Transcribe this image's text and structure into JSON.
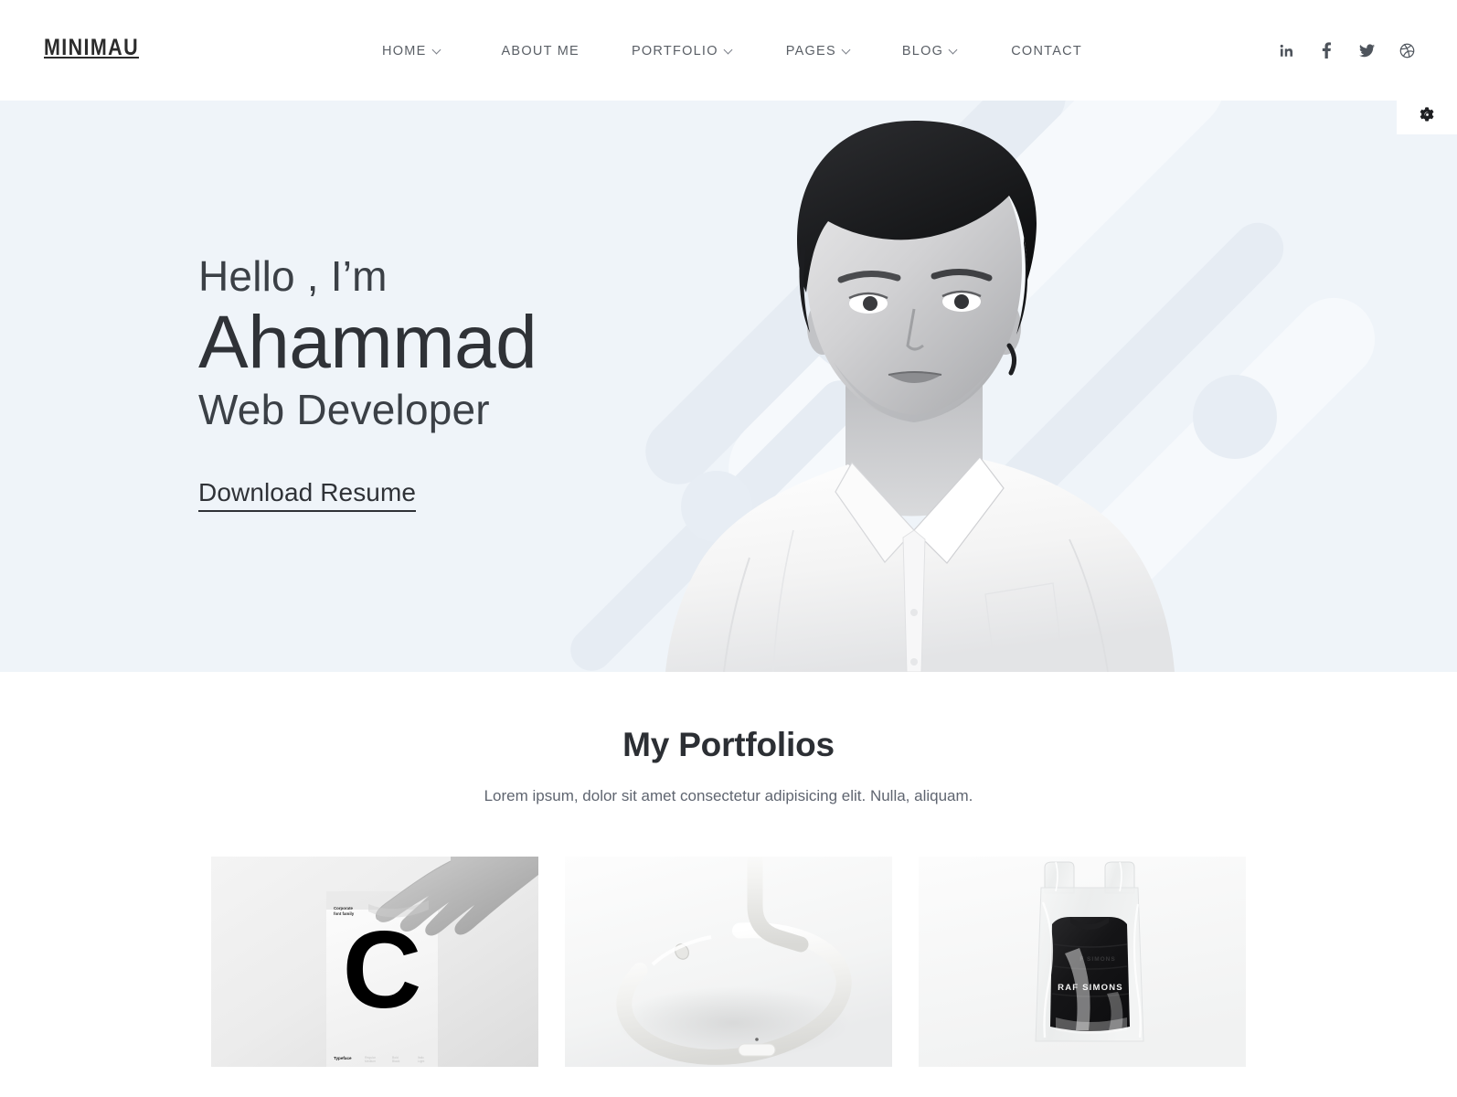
{
  "header": {
    "logo": "MINIMAU",
    "nav": [
      {
        "label": "HOME",
        "has_dropdown": true
      },
      {
        "label": "ABOUT ME",
        "has_dropdown": false
      },
      {
        "label": "PORTFOLIO",
        "has_dropdown": true
      },
      {
        "label": "PAGES",
        "has_dropdown": true
      },
      {
        "label": "BLOG",
        "has_dropdown": true
      },
      {
        "label": "CONTACT",
        "has_dropdown": false
      }
    ],
    "socials": [
      {
        "name": "linkedin-icon",
        "label": "in"
      },
      {
        "name": "facebook-icon",
        "label": "f"
      },
      {
        "name": "twitter-icon",
        "label": "twitter"
      },
      {
        "name": "dribbble-icon",
        "label": "dribbble"
      }
    ]
  },
  "settings": {
    "icon": "gear-icon",
    "label": "Settings"
  },
  "hero": {
    "greeting": "Hello , I’m",
    "name": "Ahammad",
    "role": "Web Developer",
    "cta": "Download Resume",
    "background_color": "#eff4f9",
    "photo_alt": "Black and white portrait of a young man in a white shirt"
  },
  "portfolio": {
    "title": "My Portfolios",
    "subtitle": "Lorem ipsum, dolor sit amet consectetur adipisicing elit. Nulla, aliquam.",
    "items": [
      {
        "name": "portfolio-card-typography-poster",
        "alt": "Hand holding a corporate font family poster with a large letter C",
        "poster_heading": "Corporate font family",
        "poster_letter": "C",
        "poster_footer": "Typeface"
      },
      {
        "name": "portfolio-card-white-product",
        "alt": "Minimal white curved tube product on a white background"
      },
      {
        "name": "portfolio-card-raf-simons",
        "alt": "Black garment in a transparent plastic bag",
        "garment_label": "RAF SIMONS"
      }
    ]
  },
  "colors": {
    "hero_bg": "#eff4f9",
    "page_bg": "#ffffff",
    "text_dark": "#2f3237",
    "text_muted": "#5f6570",
    "nav_text": "#5a5f66"
  }
}
